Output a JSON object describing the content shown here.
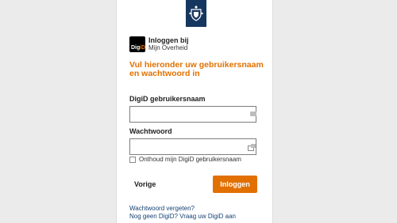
{
  "header": {
    "logo_icon": "rijksoverheid-coat-of-arms-icon"
  },
  "brand": {
    "logo_text": "DigiD",
    "title": "Inloggen bij",
    "subtitle": "Mijn Overheid"
  },
  "form": {
    "heading": "Vul hieronder uw gebruikersnaam en wachtwoord in",
    "username_label": "DigiD gebruikersnaam",
    "username_value": "",
    "password_label": "Wachtwoord",
    "password_value": "",
    "remember_label": "Onthoud mijn DigiD gebruikersnaam",
    "remember_checked": false
  },
  "actions": {
    "back_label": "Vorige",
    "login_label": "Inloggen"
  },
  "links": {
    "forgot_password": "Wachtwoord vergeten?",
    "no_digid": "Nog geen DigiD? Vraag uw DigiD aan"
  },
  "colors": {
    "accent": "#e17000",
    "gov_blue": "#15365e",
    "link": "#154273",
    "page_background": "#ebebeb"
  }
}
